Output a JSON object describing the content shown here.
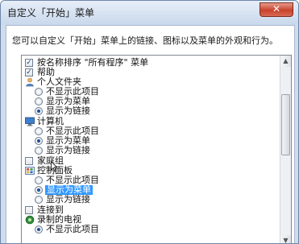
{
  "window": {
    "title": "自定义「开始」菜单",
    "close_label": "✕",
    "description": "您可以自定义「开始」菜单上的链接、图标以及菜单的外观和行为。"
  },
  "list": {
    "sort_all_programs": "按名称排序 \"所有程序\" 菜单",
    "help": "帮助",
    "personal_folder": {
      "label": "个人文件夹",
      "options": [
        "不显示此项目",
        "显示为菜单",
        "显示为链接"
      ],
      "selected": 2
    },
    "computer": {
      "label": "计算机",
      "options": [
        "不显示此项目",
        "显示为菜单",
        "显示为链接"
      ],
      "selected": 1
    },
    "homegroup": "家庭组",
    "control_panel": {
      "label": "控制面板",
      "options": [
        "不显示此项目",
        "显示为菜单",
        "显示为链接"
      ],
      "selected": 1
    },
    "connect_to": "连接到",
    "recorded_tv": {
      "label": "录制的电视",
      "options": [
        "不显示此项目"
      ],
      "selected": 0
    }
  },
  "colors": {
    "selection": "#3399ff",
    "title_bg": "#cfdcec",
    "close": "#c9422b"
  },
  "icons": [
    "folder-icon",
    "computer-icon",
    "control-panel-icon",
    "tv-icon",
    "checkmark-icon"
  ]
}
